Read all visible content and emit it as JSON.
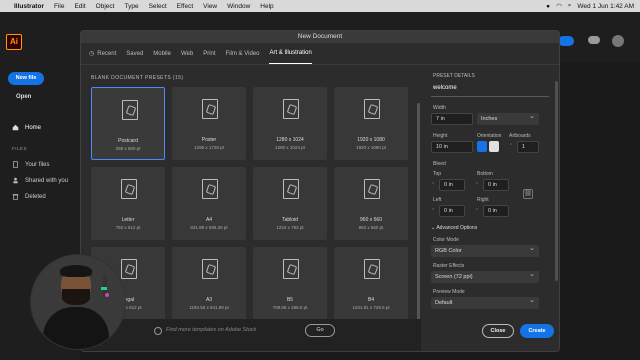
{
  "menubar": {
    "app": "Illustrator",
    "items": [
      "File",
      "Edit",
      "Object",
      "Type",
      "Select",
      "Effect",
      "View",
      "Window",
      "Help"
    ],
    "datetime": "Wed 1 Jun  1:42 AM"
  },
  "home": {
    "logo": "Ai",
    "new_file": "New file",
    "open": "Open",
    "nav_home": "Home",
    "files_heading": "FILES",
    "your_files": "Your files",
    "shared": "Shared with you",
    "deleted": "Deleted"
  },
  "dialog": {
    "title": "New Document",
    "tabs": [
      "Recent",
      "Saved",
      "Mobile",
      "Web",
      "Print",
      "Film & Video",
      "Art & Illustration"
    ],
    "active_tab": "Art & Illustration",
    "presets_heading": "BLANK DOCUMENT PRESETS  (15)",
    "presets": [
      {
        "name": "Postcard",
        "size": "288 x 560 pt",
        "selected": true
      },
      {
        "name": "Poster",
        "size": "1296 x 1728 pt"
      },
      {
        "name": "1280 x 1024",
        "size": "1280 x 1024 pt"
      },
      {
        "name": "1920 x 1080",
        "size": "1920 x 1080 pt"
      },
      {
        "name": "Letter",
        "size": "792 x 612 pt"
      },
      {
        "name": "A4",
        "size": "841.89 x 595.28 pt"
      },
      {
        "name": "Tabloid",
        "size": "1224 x 792 pt"
      },
      {
        "name": "960 x 560",
        "size": "960 x 560 pt"
      },
      {
        "name": "Legal",
        "size": "1008 x 612 pt"
      },
      {
        "name": "A3",
        "size": "1190.55 x 841.89 pt"
      },
      {
        "name": "B5",
        "size": "708.66 x 498.9 pt"
      },
      {
        "name": "B4",
        "size": "1031.81 x 728.5 pt"
      }
    ],
    "search_placeholder": "Find more templates on Adobe Stock",
    "go": "Go",
    "details": {
      "heading": "PRESET DETAILS",
      "name": "welcome",
      "width_label": "Width",
      "width": "7 in",
      "units": "Inches",
      "height_label": "Height",
      "height": "10 in",
      "orientation_label": "Orientation",
      "artboards_label": "Artboards",
      "artboards": "1",
      "bleed_label": "Bleed",
      "top_label": "Top",
      "top": "0 in",
      "bottom_label": "Bottom",
      "bottom": "0 in",
      "left_label": "Left",
      "left": "0 in",
      "right_label": "Right",
      "right": "0 in",
      "advanced": "Advanced Options",
      "color_mode_label": "Color Mode",
      "color_mode": "RGB Color",
      "raster_label": "Raster Effects",
      "raster": "Screen (72 ppi)",
      "preview_label": "Preview Mode",
      "preview": "Default"
    },
    "close": "Close",
    "create": "Create"
  },
  "colors": {
    "accent": "#1473e6",
    "selection": "#4b8df8"
  }
}
